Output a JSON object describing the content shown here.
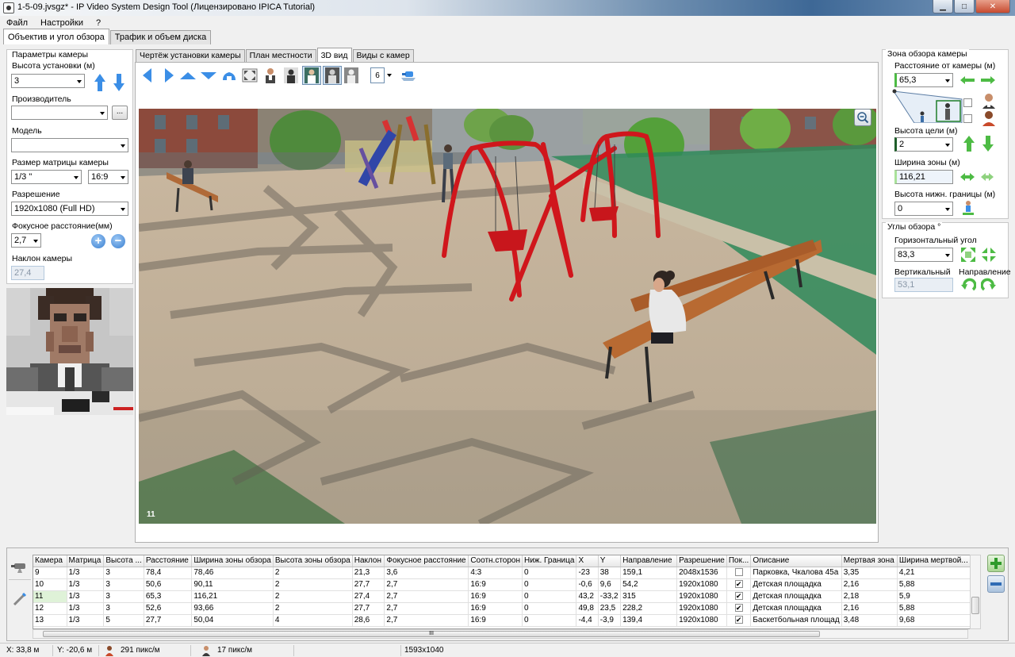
{
  "window": {
    "title": "1-5-09.jvsgz* - IP Video System Design Tool (Лицензировано  IPICA Tutorial)"
  },
  "menu": [
    "Файл",
    "Настройки",
    "?"
  ],
  "main_tabs": [
    "Объектив и угол обзора",
    "Трафик и объем диска"
  ],
  "left_panel": {
    "group_title": "Параметры камеры",
    "height_label": "Высота установки (м)",
    "height_value": "3",
    "manufacturer_label": "Производитель",
    "manufacturer_value": "",
    "browse_label": "...",
    "model_label": "Модель",
    "model_value": "",
    "sensor_label": "Размер матрицы камеры",
    "sensor_value": "1/3 \"",
    "aspect_value": "16:9",
    "resolution_label": "Разрешение",
    "resolution_value": "1920x1080 (Full HD)",
    "focal_label": "Фокусное расстояние(мм)",
    "focal_value": "2,7",
    "tilt_label": "Наклон камеры",
    "tilt_value": "27,4"
  },
  "center_tabs": [
    "Чертёж установки камеры",
    "План местности",
    "3D вид",
    "Виды с камер"
  ],
  "toolbar": {
    "count_value": "6"
  },
  "viewport": {
    "camera_label": "11"
  },
  "right_panel": {
    "zone_title": "Зона обзора камеры",
    "distance_label": "Расстояние от камеры (м)",
    "distance_value": "65,3",
    "target_height_label": "Высота цели (м)",
    "target_height_value": "2",
    "zone_width_label": "Ширина зоны (м)",
    "zone_width_value": "116,21",
    "lower_bound_label": "Высота нижн. границы (м)",
    "lower_bound_value": "0",
    "angles_title": "Углы обзора °",
    "horiz_label": "Горизонтальный угол",
    "horiz_value": "83,3",
    "vert_label": "Вертикальный",
    "vert_value": "53,1",
    "direction_label": "Направление"
  },
  "table": {
    "columns": [
      "Камера",
      "Матрица",
      "Высота ...",
      "Расстояние",
      "Ширина зоны обзора",
      "Высота зоны обзора",
      "Наклон",
      "Фокусное расстояние",
      "Соотн.сторон",
      "Ниж. Граница",
      "X",
      "Y",
      "Направление",
      "Разрешение",
      "Пок...",
      "Описание",
      "Мертвая зона",
      "Ширина мертвой...",
      "П"
    ],
    "rows": [
      [
        "9",
        "1/3",
        "3",
        "78,4",
        "78,46",
        "2",
        "21,3",
        "3,6",
        "4:3",
        "0",
        "-23",
        "38",
        "159,1",
        "2048x1536",
        "",
        "Парковка, Чкалова 45а",
        "3,35",
        "4,21",
        ""
      ],
      [
        "10",
        "1/3",
        "3",
        "50,6",
        "90,11",
        "2",
        "27,7",
        "2,7",
        "16:9",
        "0",
        "-0,6",
        "9,6",
        "54,2",
        "1920x1080",
        "✔",
        "Детская площадка",
        "2,16",
        "5,88",
        ""
      ],
      [
        "11",
        "1/3",
        "3",
        "65,3",
        "116,21",
        "2",
        "27,4",
        "2,7",
        "16:9",
        "0",
        "43,2",
        "-33,2",
        "315",
        "1920x1080",
        "✔",
        "Детская площадка",
        "2,18",
        "5,9",
        ""
      ],
      [
        "12",
        "1/3",
        "3",
        "52,6",
        "93,66",
        "2",
        "27,7",
        "2,7",
        "16:9",
        "0",
        "49,8",
        "23,5",
        "228,2",
        "1920x1080",
        "✔",
        "Детская площадка",
        "2,16",
        "5,88",
        ""
      ],
      [
        "13",
        "1/3",
        "5",
        "27,7",
        "50,04",
        "4",
        "28,6",
        "2,7",
        "16:9",
        "0",
        "-4,4",
        "-3,9",
        "139,4",
        "1920x1080",
        "✔",
        "Баскетбольная площад",
        "3,48",
        "9,68",
        ""
      ]
    ]
  },
  "scroll_grip": "III",
  "status": {
    "x": "X: 33,8 м",
    "y": "Y: -20,6 м",
    "pix1": "291 пикс/м",
    "pix2": "17 пикс/м",
    "size": "1593x1040"
  },
  "colors": {
    "accent_blue": "#3b8ee6",
    "accent_green": "#4dbb44",
    "swing_red": "#d0161c",
    "bench_wood": "#b86a32"
  }
}
